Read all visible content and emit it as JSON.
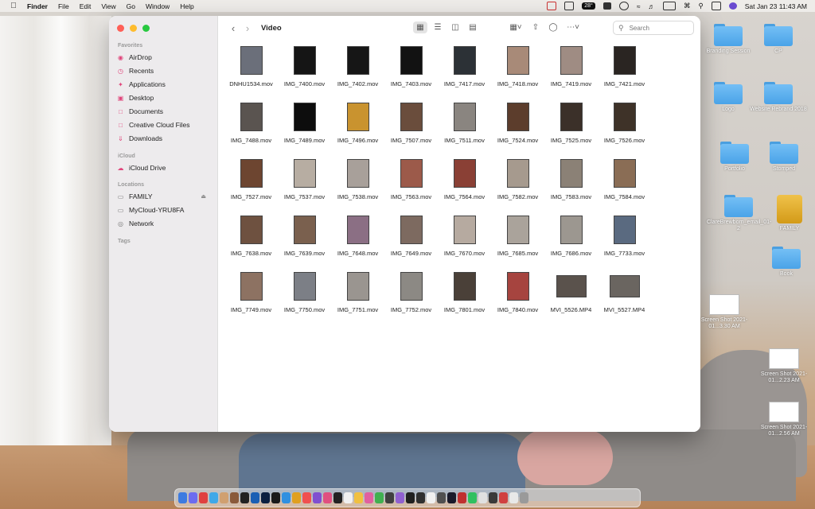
{
  "menubar": {
    "apple": "",
    "app_name": "Finder",
    "menus": [
      "File",
      "Edit",
      "View",
      "Go",
      "Window",
      "Help"
    ],
    "status_temp": "28°",
    "clock": "Sat Jan 23  11:43 AM"
  },
  "window": {
    "title": "Video",
    "search_placeholder": "Search"
  },
  "sidebar": {
    "favorites_label": "Favorites",
    "favorites": [
      {
        "label": "AirDrop",
        "icon": "airdrop-icon"
      },
      {
        "label": "Recents",
        "icon": "clock-icon"
      },
      {
        "label": "Applications",
        "icon": "applications-icon"
      },
      {
        "label": "Desktop",
        "icon": "desktop-icon"
      },
      {
        "label": "Documents",
        "icon": "document-icon"
      },
      {
        "label": "Creative Cloud Files",
        "icon": "document-icon"
      },
      {
        "label": "Downloads",
        "icon": "download-icon"
      }
    ],
    "icloud_label": "iCloud",
    "icloud": [
      {
        "label": "iCloud Drive",
        "icon": "cloud-icon"
      }
    ],
    "locations_label": "Locations",
    "locations": [
      {
        "label": "FAMILY",
        "icon": "drive-icon"
      },
      {
        "label": "MyCloud-YRU8FA",
        "icon": "display-icon"
      },
      {
        "label": "Network",
        "icon": "globe-icon"
      }
    ],
    "tags_label": "Tags"
  },
  "files": [
    {
      "name": "DNHU1534.mov",
      "color": "#6b6f7a"
    },
    {
      "name": "IMG_7400.mov",
      "color": "#151515"
    },
    {
      "name": "IMG_7402.mov",
      "color": "#161616"
    },
    {
      "name": "IMG_7403.mov",
      "color": "#121212"
    },
    {
      "name": "IMG_7417.mov",
      "color": "#2c3136"
    },
    {
      "name": "IMG_7418.mov",
      "color": "#a88a78"
    },
    {
      "name": "IMG_7419.mov",
      "color": "#9f8c83"
    },
    {
      "name": "IMG_7421.mov",
      "color": "#2a2522"
    },
    {
      "name": "IMG_7488.mov",
      "color": "#5a5450"
    },
    {
      "name": "IMG_7489.mov",
      "color": "#0d0d0d"
    },
    {
      "name": "IMG_7496.mov",
      "color": "#c9932f"
    },
    {
      "name": "IMG_7507.mov",
      "color": "#6a4d3c"
    },
    {
      "name": "IMG_7511.mov",
      "color": "#8a8580"
    },
    {
      "name": "IMG_7524.mov",
      "color": "#5c3d2c"
    },
    {
      "name": "IMG_7525.mov",
      "color": "#3b3029"
    },
    {
      "name": "IMG_7526.mov",
      "color": "#3e3228"
    },
    {
      "name": "IMG_7527.mov",
      "color": "#6d4530"
    },
    {
      "name": "IMG_7537.mov",
      "color": "#b7ada2"
    },
    {
      "name": "IMG_7538.mov",
      "color": "#a8a09a"
    },
    {
      "name": "IMG_7563.mov",
      "color": "#9c5a4a"
    },
    {
      "name": "IMG_7564.mov",
      "color": "#8a4035"
    },
    {
      "name": "IMG_7582.mov",
      "color": "#a69a8e"
    },
    {
      "name": "IMG_7583.mov",
      "color": "#8b8176"
    },
    {
      "name": "IMG_7584.mov",
      "color": "#8a6d55"
    },
    {
      "name": "IMG_7638.mov",
      "color": "#6e5140"
    },
    {
      "name": "IMG_7639.mov",
      "color": "#7a604e"
    },
    {
      "name": "IMG_7648.mov",
      "color": "#8b6f84"
    },
    {
      "name": "IMG_7649.mov",
      "color": "#7d6a60"
    },
    {
      "name": "IMG_7670.mov",
      "color": "#b6aaa0"
    },
    {
      "name": "IMG_7685.mov",
      "color": "#aaa39b"
    },
    {
      "name": "IMG_7686.mov",
      "color": "#9c9790"
    },
    {
      "name": "IMG_7733.mov",
      "color": "#5a6a80"
    },
    {
      "name": "IMG_7749.mov",
      "color": "#8d7262"
    },
    {
      "name": "IMG_7750.mov",
      "color": "#7c7f86"
    },
    {
      "name": "IMG_7751.mov",
      "color": "#9a9590"
    },
    {
      "name": "IMG_7752.mov",
      "color": "#8c8984"
    },
    {
      "name": "IMG_7801.mov",
      "color": "#4a4038"
    },
    {
      "name": "IMG_7840.mov",
      "color": "#a6443f"
    },
    {
      "name": "MVI_5526.MP4",
      "color": "#5a524c",
      "wide": true
    },
    {
      "name": "MVI_5527.MP4",
      "color": "#6a6560",
      "wide": true
    }
  ],
  "desktop": {
    "items": [
      {
        "label": "Branding Session",
        "kind": "folder"
      },
      {
        "label": "CP",
        "kind": "folder"
      },
      {
        "label": "Logo",
        "kind": "folder"
      },
      {
        "label": "Website Rebrand 2018",
        "kind": "folder"
      },
      {
        "label": "Portfolio",
        "kind": "folder"
      },
      {
        "label": "Stomped",
        "kind": "folder"
      },
      {
        "label": "ClareBrewborn_email_01-2",
        "kind": "folder"
      },
      {
        "label": "FAMILY",
        "kind": "drive"
      },
      {
        "label": "Book",
        "kind": "folder"
      },
      {
        "label": "Screen Shot 2021-01...3.30 AM",
        "kind": "screenshot"
      },
      {
        "label": "Screen Shot 2021-01...2.23 AM",
        "kind": "screenshot"
      },
      {
        "label": "Screen Shot 2021-01...2.56 AM",
        "kind": "screenshot"
      }
    ]
  },
  "colors": {
    "accent": "#e0457b",
    "folder": "#5fb0f0"
  },
  "dock": {
    "apps": [
      "#3d7be0",
      "#6c6cf0",
      "#e04040",
      "#3fa8e8",
      "#d0a070",
      "#8a5a3a",
      "#222",
      "#1a5fb4",
      "#0c2040",
      "#1a1a1a",
      "#3090e0",
      "#e0a020",
      "#f05050",
      "#8050d0",
      "#e05080",
      "#222",
      "#f0f0f0",
      "#f0c040",
      "#e060a0",
      "#40b050",
      "#404040",
      "#9060d0",
      "#202020",
      "#303030",
      "#f0f0f0",
      "#505050",
      "#1a1a2a",
      "#c03030",
      "#30c060",
      "#e0e0e0",
      "#3a3a3a",
      "#d04040",
      "#e8e8e8",
      "#9a9a9a"
    ]
  }
}
